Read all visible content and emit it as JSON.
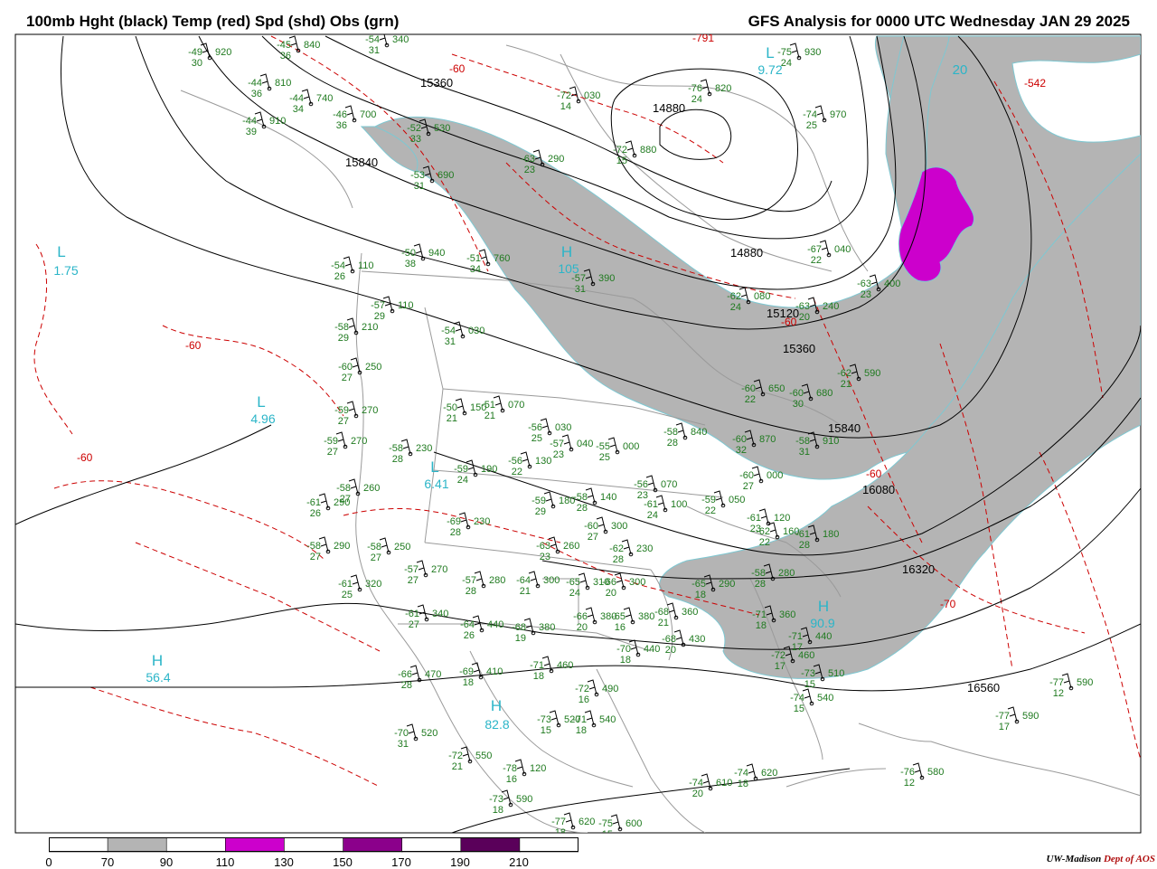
{
  "header": {
    "left_title": "100mb Hght (black) Temp (red) Spd (shd) Obs (grn)",
    "right_title": "GFS Analysis for 0000 UTC Wednesday  JAN 29 2025"
  },
  "map": {
    "pressure_centers": [
      {
        "type": "L",
        "value": "9.72"
      },
      {
        "type": "L",
        "value": "1.75"
      },
      {
        "type": "H",
        "value": "105"
      },
      {
        "type": "L",
        "value": "4.96"
      },
      {
        "type": "L",
        "value": "6.41"
      },
      {
        "type": "H",
        "value": "56.4"
      },
      {
        "type": "H",
        "value": "82.8"
      },
      {
        "type": "H",
        "value": "90.9"
      },
      {
        "type": "L",
        "value": "20"
      }
    ],
    "height_labels": [
      "15360",
      "14880",
      "15840",
      "14880",
      "15120",
      "15360",
      "15840",
      "16080",
      "16320",
      "16560"
    ],
    "temp_labels": [
      "-60",
      "-60",
      "-60",
      "-60",
      "-70",
      "-542",
      "-791",
      "-60"
    ],
    "observations": [
      {
        "t": "-49",
        "h": "920",
        "d": "30"
      },
      {
        "t": "-45",
        "h": "840",
        "d": "36"
      },
      {
        "t": "-54",
        "h": "340",
        "d": "31"
      },
      {
        "t": "-44",
        "h": "810",
        "d": "36"
      },
      {
        "t": "-44",
        "h": "740",
        "d": "34"
      },
      {
        "t": "-46",
        "h": "700",
        "d": "36"
      },
      {
        "t": "-44",
        "h": "910",
        "d": "39"
      },
      {
        "t": "-52",
        "h": "530",
        "d": "33"
      },
      {
        "t": "-63",
        "h": "290",
        "d": "23"
      },
      {
        "t": "-53",
        "h": "690",
        "d": "31"
      },
      {
        "t": "-72",
        "h": "030",
        "d": "14"
      },
      {
        "t": "-72",
        "h": "880",
        "d": "15"
      },
      {
        "t": "-76",
        "h": "820",
        "d": "24"
      },
      {
        "t": "-75",
        "h": "930",
        "d": "24"
      },
      {
        "t": "-74",
        "h": "970",
        "d": "25"
      },
      {
        "t": "-50",
        "h": "940",
        "d": "38"
      },
      {
        "t": "-51",
        "h": "760",
        "d": "34"
      },
      {
        "t": "-54",
        "h": "110",
        "d": "26"
      },
      {
        "t": "-57",
        "h": "110",
        "d": "29"
      },
      {
        "t": "-57",
        "h": "390",
        "d": "31"
      },
      {
        "t": "-54",
        "h": "030",
        "d": "31"
      },
      {
        "t": "-58",
        "h": "210",
        "d": "29"
      },
      {
        "t": "-60",
        "h": "250",
        "d": "27"
      },
      {
        "t": "-59",
        "h": "270",
        "d": "27"
      },
      {
        "t": "-59",
        "h": "270",
        "d": "27"
      },
      {
        "t": "-58",
        "h": "230",
        "d": "28"
      },
      {
        "t": "-58",
        "h": "260",
        "d": "27"
      },
      {
        "t": "-61",
        "h": "290",
        "d": "26"
      },
      {
        "t": "-58",
        "h": "290",
        "d": "27"
      },
      {
        "t": "-58",
        "h": "250",
        "d": "27"
      },
      {
        "t": "-61",
        "h": "320",
        "d": "25"
      },
      {
        "t": "-57",
        "h": "270",
        "d": "27"
      },
      {
        "t": "-61",
        "h": "340",
        "d": "27"
      },
      {
        "t": "-69",
        "h": "230",
        "d": "28"
      },
      {
        "t": "-57",
        "h": "280",
        "d": "28"
      },
      {
        "t": "-64",
        "h": "440",
        "d": "26"
      },
      {
        "t": "-68",
        "h": "380",
        "d": "19"
      },
      {
        "t": "-66",
        "h": "470",
        "d": "28"
      },
      {
        "t": "-69",
        "h": "410",
        "d": "18"
      },
      {
        "t": "-71",
        "h": "460",
        "d": "18"
      },
      {
        "t": "-70",
        "h": "520",
        "d": "31"
      },
      {
        "t": "-72",
        "h": "550",
        "d": "21"
      },
      {
        "t": "-72",
        "h": "490",
        "d": "16"
      },
      {
        "t": "-73",
        "h": "520",
        "d": "15"
      },
      {
        "t": "-71",
        "h": "540",
        "d": "18"
      },
      {
        "t": "-78",
        "h": "120",
        "d": "16"
      },
      {
        "t": "-73",
        "h": "590",
        "d": "18"
      },
      {
        "t": "-77",
        "h": "620",
        "d": "18"
      },
      {
        "t": "-75",
        "h": "600",
        "d": "15"
      },
      {
        "t": "-63",
        "h": "400",
        "d": "23"
      },
      {
        "t": "-67",
        "h": "040",
        "d": "22"
      },
      {
        "t": "-62",
        "h": "080",
        "d": "24"
      },
      {
        "t": "-63",
        "h": "240",
        "d": "20"
      },
      {
        "t": "-62",
        "h": "590",
        "d": "21"
      },
      {
        "t": "-60",
        "h": "650",
        "d": "22"
      },
      {
        "t": "-60",
        "h": "680",
        "d": "30"
      },
      {
        "t": "-60",
        "h": "870",
        "d": "32"
      },
      {
        "t": "-58",
        "h": "840",
        "d": "28"
      },
      {
        "t": "-58",
        "h": "910",
        "d": "31"
      },
      {
        "t": "-60",
        "h": "000",
        "d": "27"
      },
      {
        "t": "-59",
        "h": "050",
        "d": "22"
      },
      {
        "t": "-61",
        "h": "120",
        "d": "23"
      },
      {
        "t": "-62",
        "h": "160",
        "d": "22"
      },
      {
        "t": "-61",
        "h": "180",
        "d": "28"
      },
      {
        "t": "-58",
        "h": "280",
        "d": "28"
      },
      {
        "t": "-65",
        "h": "290",
        "d": "18"
      },
      {
        "t": "-71",
        "h": "360",
        "d": "18"
      },
      {
        "t": "-71",
        "h": "440",
        "d": "17"
      },
      {
        "t": "-72",
        "h": "460",
        "d": "17"
      },
      {
        "t": "-73",
        "h": "510",
        "d": "15"
      },
      {
        "t": "-74",
        "h": "540",
        "d": "15"
      },
      {
        "t": "-77",
        "h": "590",
        "d": "12"
      },
      {
        "t": "-77",
        "h": "590",
        "d": "17"
      },
      {
        "t": "-76",
        "h": "580",
        "d": "12"
      },
      {
        "t": "-74",
        "h": "610",
        "d": "20"
      },
      {
        "t": "-74",
        "h": "620",
        "d": "18"
      },
      {
        "t": "-50",
        "h": "150",
        "d": "21"
      },
      {
        "t": "-51",
        "h": "070",
        "d": "21"
      },
      {
        "t": "-56",
        "h": "030",
        "d": "25"
      },
      {
        "t": "-57",
        "h": "040",
        "d": "23"
      },
      {
        "t": "-55",
        "h": "000",
        "d": "25"
      },
      {
        "t": "-59",
        "h": "190",
        "d": "24"
      },
      {
        "t": "-56",
        "h": "130",
        "d": "22"
      },
      {
        "t": "-59",
        "h": "180",
        "d": "29"
      },
      {
        "t": "-58",
        "h": "140",
        "d": "28"
      },
      {
        "t": "-56",
        "h": "070",
        "d": "23"
      },
      {
        "t": "-61",
        "h": "100",
        "d": "24"
      },
      {
        "t": "-60",
        "h": "300",
        "d": "27"
      },
      {
        "t": "-63",
        "h": "260",
        "d": "23"
      },
      {
        "t": "-62",
        "h": "230",
        "d": "28"
      },
      {
        "t": "-65",
        "h": "310",
        "d": "24"
      },
      {
        "t": "-64",
        "h": "300",
        "d": "21"
      },
      {
        "t": "-66",
        "h": "300",
        "d": "20"
      },
      {
        "t": "-66",
        "h": "380",
        "d": "20"
      },
      {
        "t": "-65",
        "h": "380",
        "d": "16"
      },
      {
        "t": "-68",
        "h": "360",
        "d": "21"
      },
      {
        "t": "-70",
        "h": "440",
        "d": "18"
      },
      {
        "t": "-68",
        "h": "430",
        "d": "20"
      }
    ]
  },
  "colorbar": {
    "bins": [
      {
        "color": "#ffffff"
      },
      {
        "color": "#b4b4b4"
      },
      {
        "color": "#ffffff"
      },
      {
        "color": "#cc00cc"
      },
      {
        "color": "#ffffff"
      },
      {
        "color": "#8b008b"
      },
      {
        "color": "#ffffff"
      },
      {
        "color": "#5a005a"
      },
      {
        "color": "#ffffff"
      }
    ],
    "labels": [
      "0",
      "70",
      "90",
      "110",
      "130",
      "150",
      "170",
      "190",
      "210"
    ]
  },
  "credit": {
    "org": "UW-Madison",
    "dept": "Dept of AOS"
  }
}
